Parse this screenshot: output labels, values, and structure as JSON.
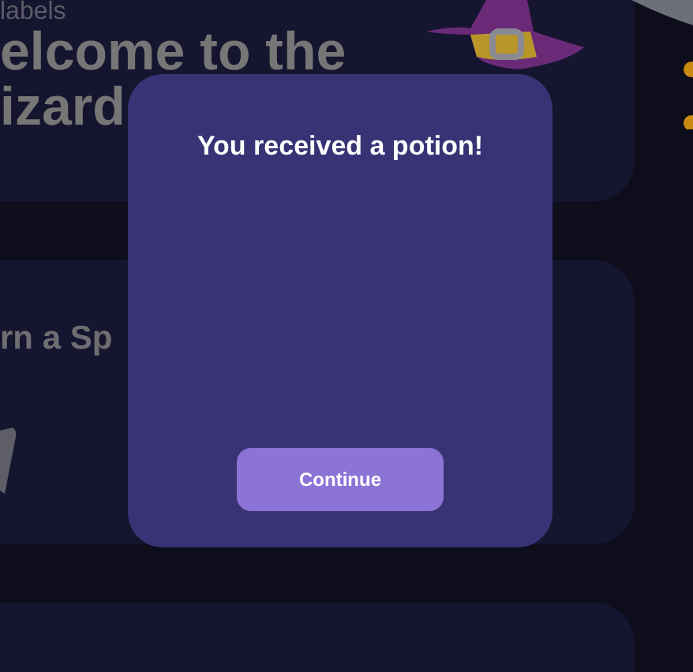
{
  "background": {
    "cards": [
      {
        "kind": "welcome",
        "caption": "labels",
        "title_lines": [
          "elcome to the",
          "izard"
        ]
      },
      {
        "kind": "lesson",
        "title": "rn a Sp"
      },
      {
        "kind": "empty"
      }
    ]
  },
  "dialog": {
    "title": "You received a potion!",
    "button": "Continue"
  }
}
